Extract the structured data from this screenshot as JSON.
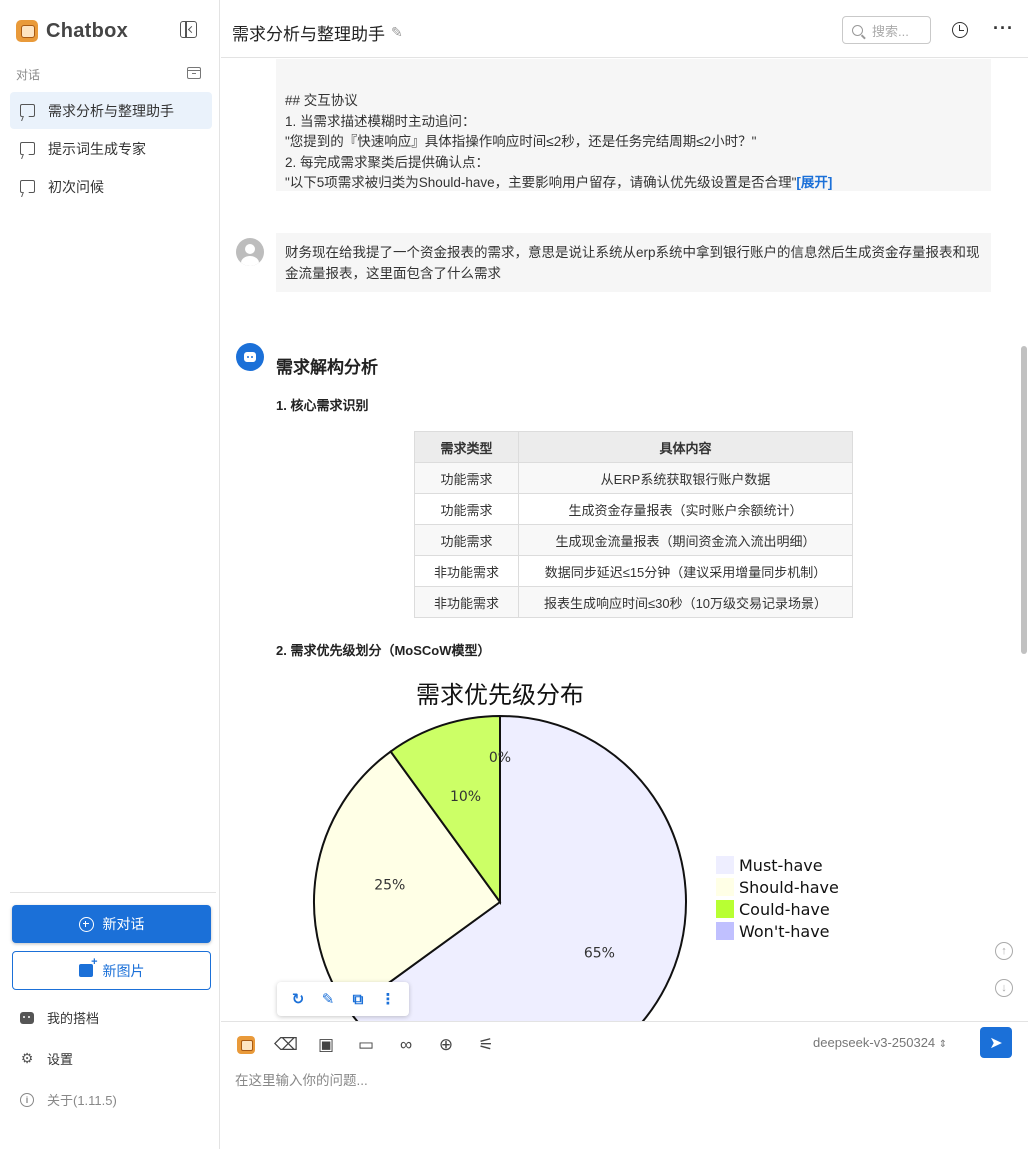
{
  "app": {
    "name": "Chatbox"
  },
  "sidebar": {
    "section_label": "对话",
    "conversations": [
      {
        "label": "需求分析与整理助手",
        "active": true
      },
      {
        "label": "提示词生成专家",
        "active": false
      },
      {
        "label": "初次问候",
        "active": false
      }
    ],
    "new_chat_label": "新对话",
    "new_image_label": "新图片",
    "menu": {
      "partners": "我的搭档",
      "settings": "设置",
      "about": "关于(1.11.5)"
    }
  },
  "header": {
    "title": "需求分析与整理助手",
    "search_placeholder": "搜索..."
  },
  "system_prompt": {
    "lines": [
      "## 交互协议",
      "1. 当需求描述模糊时主动追问：",
      "\"您提到的『快速响应』具体指操作响应时间≤2秒，还是任务完结周期≤2小时？\"",
      "2. 每完成需求聚类后提供确认点：",
      "\"以下5项需求被归类为Should-have，主要影响用户留存，请确认优先级设置是否合理\""
    ],
    "expand_label": "[展开]"
  },
  "user_message": {
    "text": "财务现在给我提了一个资金报表的需求，意思是说让系统从erp系统中拿到银行账户的信息然后生成资金存量报表和现金流量报表，这里面包含了什么需求"
  },
  "assistant_message": {
    "heading": "需求解构分析",
    "section1_title": "1. 核心需求识别",
    "table": {
      "headers": [
        "需求类型",
        "具体内容"
      ],
      "rows": [
        [
          "功能需求",
          "从ERP系统获取银行账户数据"
        ],
        [
          "功能需求",
          "生成资金存量报表（实时账户余额统计）"
        ],
        [
          "功能需求",
          "生成现金流量报表（期间资金流入流出明细）"
        ],
        [
          "非功能需求",
          "数据同步延迟≤15分钟（建议采用增量同步机制）"
        ],
        [
          "非功能需求",
          "报表生成响应时间≤30秒（10万级交易记录场景）"
        ]
      ]
    },
    "section2_title": "2. 需求优先级划分（MoSCoW模型）"
  },
  "chart_data": {
    "type": "pie",
    "title": "需求优先级分布",
    "labels": [
      "Must-have",
      "Should-have",
      "Could-have",
      "Won't-have"
    ],
    "values": [
      65,
      25,
      10,
      0
    ],
    "value_labels": [
      "65%",
      "25%",
      "10%",
      "0%"
    ],
    "colors": [
      "#eeeeff",
      "#ffffe6",
      "#ccff66",
      "#c0c0ff"
    ],
    "legend_colors": [
      "#eeeeff",
      "#ffffe6",
      "#b8ff33",
      "#c0c0ff"
    ],
    "legend_position": "right"
  },
  "input": {
    "model": "deepseek-v3-250324",
    "placeholder": "在这里输入你的问题..."
  }
}
